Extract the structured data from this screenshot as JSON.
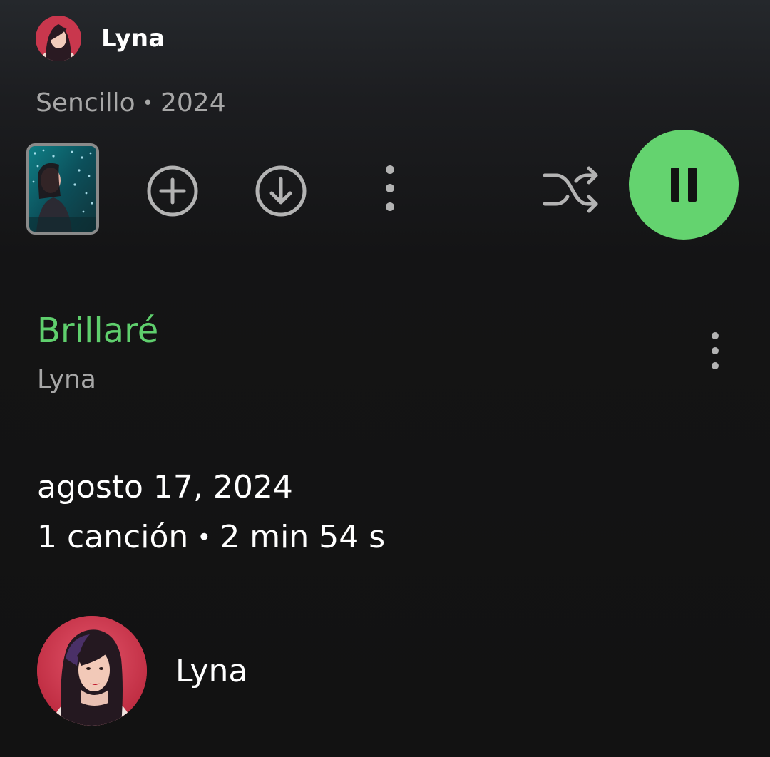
{
  "header": {
    "artist_name": "Lyna",
    "release_type": "Sencillo",
    "separator": "•",
    "year": "2024"
  },
  "actions": {
    "thumbnail_icon": "album-thumbnail",
    "add_icon": "add-circle-icon",
    "download_icon": "download-circle-icon",
    "more_icon": "more-vertical-icon",
    "shuffle_icon": "shuffle-icon",
    "play_state_icon": "pause-icon",
    "accent_color": "#64d36f"
  },
  "track": {
    "title": "Brillaré",
    "artist": "Lyna",
    "title_color": "#5fcf6d"
  },
  "release": {
    "date": "agosto 17, 2024",
    "song_count": "1 canción",
    "separator": "•",
    "duration": "2 min 54 s"
  },
  "artist_card": {
    "name": "Lyna"
  }
}
